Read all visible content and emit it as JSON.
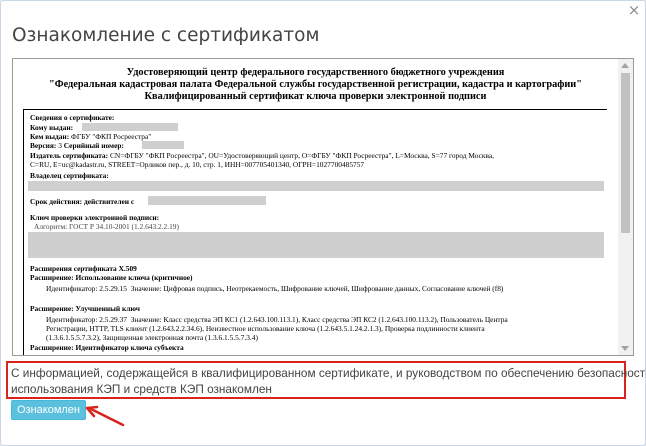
{
  "dialog": {
    "title": "Ознакомление с сертификатом",
    "close_glyph": "×"
  },
  "certificate": {
    "header_lines": [
      "Удостоверяющий центр федерального государственного бюджетного учреждения",
      "\"Федеральная кадастровая палата Федеральной службы государственной регистрации, кадастра и картографии\"",
      "Квалифицированный сертификат ключа проверки электронной подписи"
    ],
    "info_title": "Сведения о сертификате:",
    "issued_to_label": "Кому выдан:",
    "issued_by_label": "Кем выдан:",
    "issued_by_value": "ФГБУ \"ФКП Росреестра\"",
    "version_label": "Версия:",
    "version_value": "3",
    "serial_label": "Серийный номер:",
    "issuer_label": "Издатель сертификата:",
    "issuer_value_1": "CN=ФГБУ \"ФКП Росреестра\", OU=Удостоверяющий центр, O=ФГБУ \"ФКП Росреестра\", L=Москва, S=77 город Москва,",
    "issuer_value_2": "C=RU, E=uc@kadastr.ru, STREET=Орликов пер., д. 10, стр. 1, ИНН=007705401340, ОГРН=1027700485757",
    "owner_label": "Владелец сертификата:",
    "validity_label": "Срок действия: действителен с",
    "key_label": "Ключ проверки электронной подписи:",
    "algorithm_label": "Алгоритм:",
    "algorithm_value": "ГОСТ Р 34.10-2001 (1.2.643.2.2.19)",
    "x509_label": "Расширения сертификата X.509",
    "key_usage_label": "Расширение: Использование ключа (критичное)",
    "key_usage_id_label": "Идентификатор:",
    "key_usage_id_value": "2.5.29.15",
    "key_usage_val_label": "Значение:",
    "key_usage_val_value": "Цифровая подпись, Неотрекаемость, Шифрование ключей, Шифрование данных, Согласование ключей (f8)",
    "ext_key_usage_label": "Расширение: Улучшенный ключ",
    "ext_id_label": "Идентификатор:",
    "ext_id_value": "2.5.29.37",
    "ext_val_label": "Значение:",
    "ext_val_value_1": "Класс средства ЭП КС1 (1.2.643.100.113.1), Класс средства ЭП КС2 (1.2.643.100.113.2), Пользователь Центра",
    "ext_val_value_2": "Регистрации, HTTP, TLS клиент (1.2.643.2.2.34.6), Неизвестное использование ключа (1.2.643.5.1.24.2.1.3), Проверка подлинности клиента",
    "ext_val_value_3": "(1.3.6.1.5.5.7.3.2), Защищенная электронная почта (1.3.6.1.5.5.7.3.4)",
    "subject_key_label": "Расширение: Идентификатор ключа субъекта"
  },
  "agreement": {
    "line_1": "С информацией, содержащейся в квалифицированном сертификате, и руководством по обеспечению безопасности",
    "line_2": "использования КЭП и средств КЭП ознакомлен"
  },
  "confirm_button": {
    "label": "Ознакомлен"
  },
  "colors": {
    "accent_button": "#5bc0de",
    "highlight_border": "#d9231d",
    "annotation_arrow": "#d9231d"
  }
}
